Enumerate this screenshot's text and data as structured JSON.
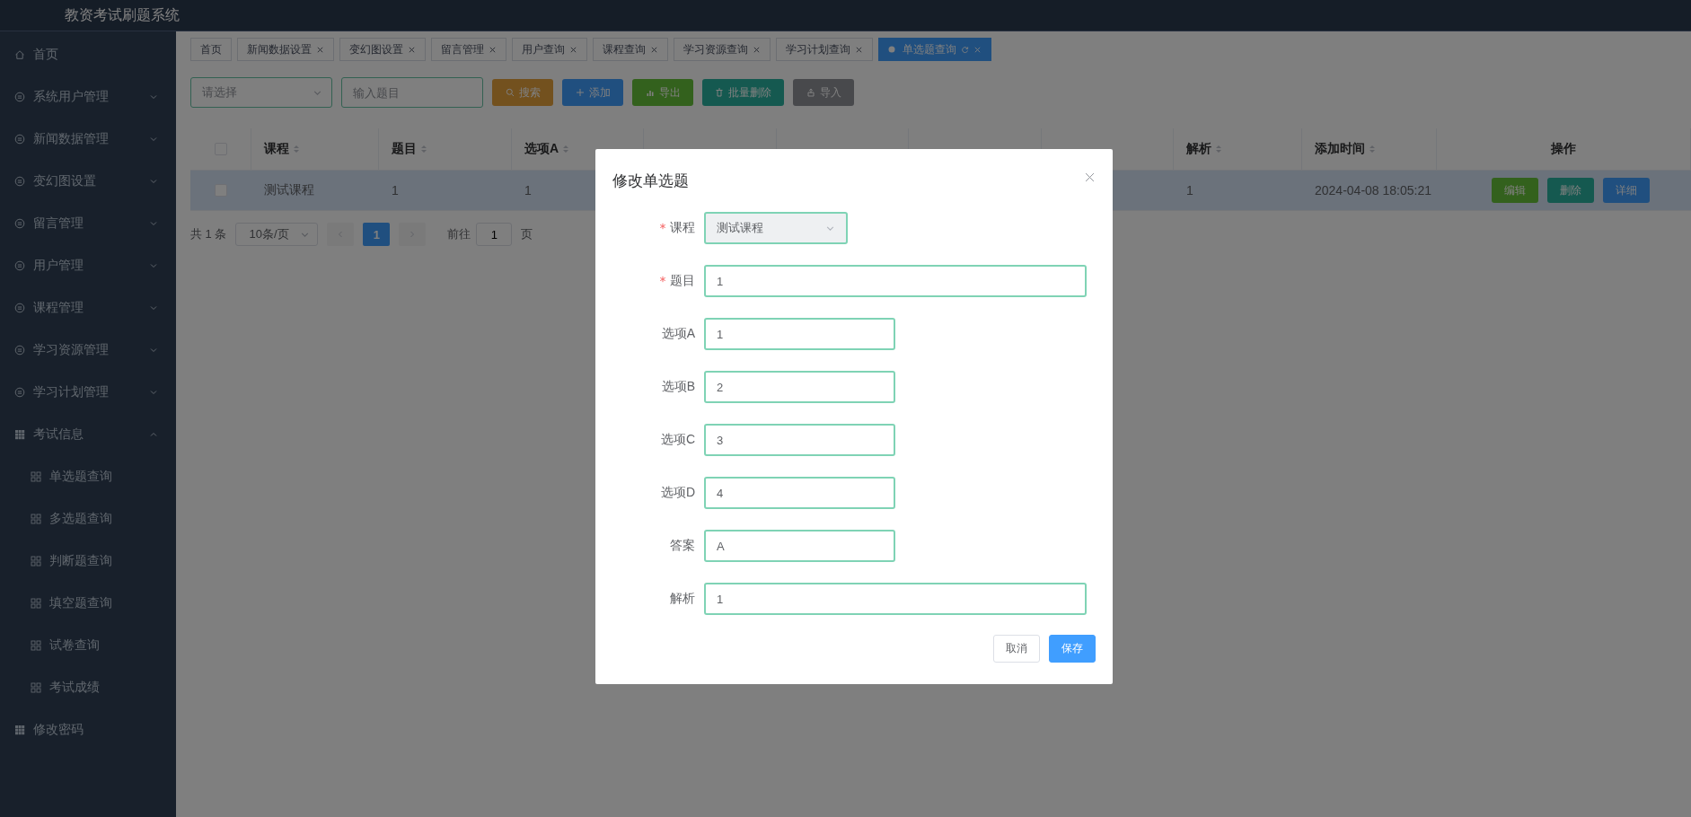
{
  "app_title": "教资考试刷题系统",
  "sidebar": {
    "items": [
      {
        "label": "首页",
        "kind": "home"
      },
      {
        "label": "系统用户管理",
        "kind": "group",
        "expanded": false
      },
      {
        "label": "新闻数据管理",
        "kind": "group",
        "expanded": false
      },
      {
        "label": "变幻图设置",
        "kind": "group",
        "expanded": false
      },
      {
        "label": "留言管理",
        "kind": "group",
        "expanded": false
      },
      {
        "label": "用户管理",
        "kind": "group",
        "expanded": false
      },
      {
        "label": "课程管理",
        "kind": "group",
        "expanded": false
      },
      {
        "label": "学习资源管理",
        "kind": "group",
        "expanded": false
      },
      {
        "label": "学习计划管理",
        "kind": "group",
        "expanded": false
      },
      {
        "label": "考试信息",
        "kind": "menu",
        "expanded": true,
        "children": [
          {
            "label": "单选题查询"
          },
          {
            "label": "多选题查询"
          },
          {
            "label": "判断题查询"
          },
          {
            "label": "填空题查询"
          },
          {
            "label": "试卷查询"
          },
          {
            "label": "考试成绩"
          }
        ]
      },
      {
        "label": "修改密码",
        "kind": "menu"
      }
    ]
  },
  "tabs": [
    {
      "label": "首页",
      "selected": false,
      "closable": false
    },
    {
      "label": "新闻数据设置",
      "selected": false,
      "closable": true
    },
    {
      "label": "变幻图设置",
      "selected": false,
      "closable": true
    },
    {
      "label": "留言管理",
      "selected": false,
      "closable": true
    },
    {
      "label": "用户查询",
      "selected": false,
      "closable": true
    },
    {
      "label": "课程查询",
      "selected": false,
      "closable": true
    },
    {
      "label": "学习资源查询",
      "selected": false,
      "closable": true
    },
    {
      "label": "学习计划查询",
      "selected": false,
      "closable": true
    },
    {
      "label": "单选题查询",
      "selected": true,
      "closable": true
    }
  ],
  "toolbar": {
    "course_select": {
      "placeholder": "请选择"
    },
    "title_search": {
      "placeholder": "输入题目"
    },
    "buttons": [
      {
        "label": "搜索",
        "kind": "search"
      },
      {
        "label": "添加",
        "kind": "add"
      },
      {
        "label": "导出",
        "kind": "export"
      },
      {
        "label": "批量删除",
        "kind": "batch_delete"
      },
      {
        "label": "导入",
        "kind": "import"
      }
    ]
  },
  "table": {
    "select_all": {
      "checked": false
    },
    "columns": [
      {
        "label": "课程",
        "sortable": true
      },
      {
        "label": "题目",
        "sortable": true
      },
      {
        "label": "选项A",
        "sortable": true
      },
      {
        "label": "解析",
        "sortable": true
      },
      {
        "label": "添加时间",
        "sortable": true
      },
      {
        "label": "操作"
      }
    ],
    "rows": [
      {
        "checked": false,
        "highlighted": true,
        "course": "测试课程",
        "title": "1",
        "option_a": "1",
        "analysis": "1",
        "added_time": "2024-04-08 18:05:21",
        "actions": [
          {
            "label": "编辑",
            "kind": "edit"
          },
          {
            "label": "删除",
            "kind": "delete"
          },
          {
            "label": "详细",
            "kind": "detail"
          }
        ]
      }
    ]
  },
  "pagination": {
    "total": "共 1 条",
    "page_size": "10条/页",
    "pages": [
      {
        "label": "1",
        "selected": true
      }
    ],
    "goto_label": "前往",
    "goto_value": "1",
    "goto_suffix": "页"
  },
  "dialog": {
    "title": "修改单选题",
    "fields": [
      {
        "label": "课程",
        "required": true,
        "kind": "select",
        "value": "测试课程"
      },
      {
        "label": "题目",
        "required": true,
        "kind": "wide",
        "value": "1"
      },
      {
        "label": "选项A",
        "required": false,
        "kind": "narrow",
        "value": "1"
      },
      {
        "label": "选项B",
        "required": false,
        "kind": "narrow",
        "value": "2"
      },
      {
        "label": "选项C",
        "required": false,
        "kind": "narrow",
        "value": "3"
      },
      {
        "label": "选项D",
        "required": false,
        "kind": "narrow",
        "value": "4"
      },
      {
        "label": "答案",
        "required": false,
        "kind": "narrow",
        "value": "A"
      },
      {
        "label": "解析",
        "required": false,
        "kind": "wide",
        "value": "1"
      }
    ],
    "buttons": [
      {
        "label": "取消",
        "kind": "cancel"
      },
      {
        "label": "保存",
        "kind": "primary"
      }
    ]
  }
}
